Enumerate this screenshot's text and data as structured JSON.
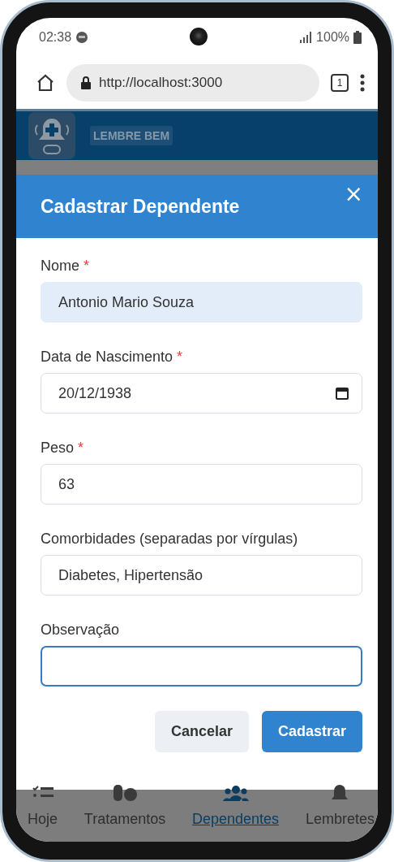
{
  "status_bar": {
    "time": "02:38",
    "battery": "100%"
  },
  "browser": {
    "url": "http://localhost:3000",
    "tab_count": "1"
  },
  "app_header": {
    "brand": "LEMBRE BEM"
  },
  "modal": {
    "title": "Cadastrar Dependente",
    "close": "×",
    "fields": [
      {
        "label": "Nome",
        "required_mark": "*",
        "kind": "text",
        "value": "Antonio Mario Souza",
        "autofilled": true,
        "focused": false
      },
      {
        "label": "Data de Nascimento",
        "required_mark": "*",
        "kind": "date",
        "value": "20/12/1938",
        "autofilled": false,
        "focused": false
      },
      {
        "label": "Peso",
        "required_mark": "*",
        "kind": "text",
        "value": "63",
        "autofilled": false,
        "focused": false
      },
      {
        "label": "Comorbidades (separadas por vírgulas)",
        "kind": "text",
        "value": "Diabetes, Hipertensão",
        "autofilled": false,
        "focused": false
      },
      {
        "label": "Observação",
        "kind": "text",
        "autofilled": false,
        "focused": true
      }
    ],
    "buttons": [
      {
        "label": "Cancelar",
        "kind": "secondary"
      },
      {
        "label": "Cadastrar",
        "kind": "primary"
      }
    ]
  },
  "bottom_nav": [
    {
      "label": "Hoje",
      "selected": false
    },
    {
      "label": "Tratamentos",
      "selected": false
    },
    {
      "label": "Dependentes",
      "selected": true
    },
    {
      "label": "Lembretes",
      "selected": false
    }
  ]
}
